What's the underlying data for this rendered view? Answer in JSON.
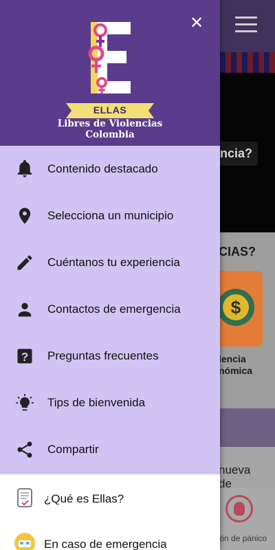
{
  "background": {
    "hero_caption": "ncia?",
    "section_title": "CIAS?",
    "card_label_line1": "lencia",
    "card_label_line2": "nómica",
    "news_line1": "nueva",
    "news_line2": "de",
    "panic_label": "tón de pánico",
    "coin_symbol": "$"
  },
  "drawer": {
    "header": {
      "logo_letter": "E",
      "banner_text": "ELLAS",
      "subtitle_line1": "Libres de Violencias",
      "subtitle_line2": "Colombia",
      "close_icon": "close-icon"
    },
    "menu": [
      {
        "label": "Contenido destacado",
        "icon": "bell-icon"
      },
      {
        "label": "Selecciona un municipio",
        "icon": "location-pin-icon"
      },
      {
        "label": "Cuéntanos tu experiencia",
        "icon": "pencil-icon"
      },
      {
        "label": "Contactos de emergencia",
        "icon": "person-icon"
      },
      {
        "label": "Preguntas frecuentes",
        "icon": "question-box-icon"
      },
      {
        "label": "Tips de bienvenida",
        "icon": "lightbulb-icon"
      },
      {
        "label": "Compartir",
        "icon": "share-icon"
      }
    ],
    "extra": [
      {
        "label": "¿Qué es Ellas?",
        "icon": "checklist-icon"
      },
      {
        "label": "En caso de emergencia",
        "icon": "ambulance-icon"
      }
    ]
  },
  "colors": {
    "drawer_header": "#5b3b8c",
    "menu_background": "#d1c3f3",
    "banner_yellow": "#f2df75",
    "logo_pink": "#e0478b"
  }
}
